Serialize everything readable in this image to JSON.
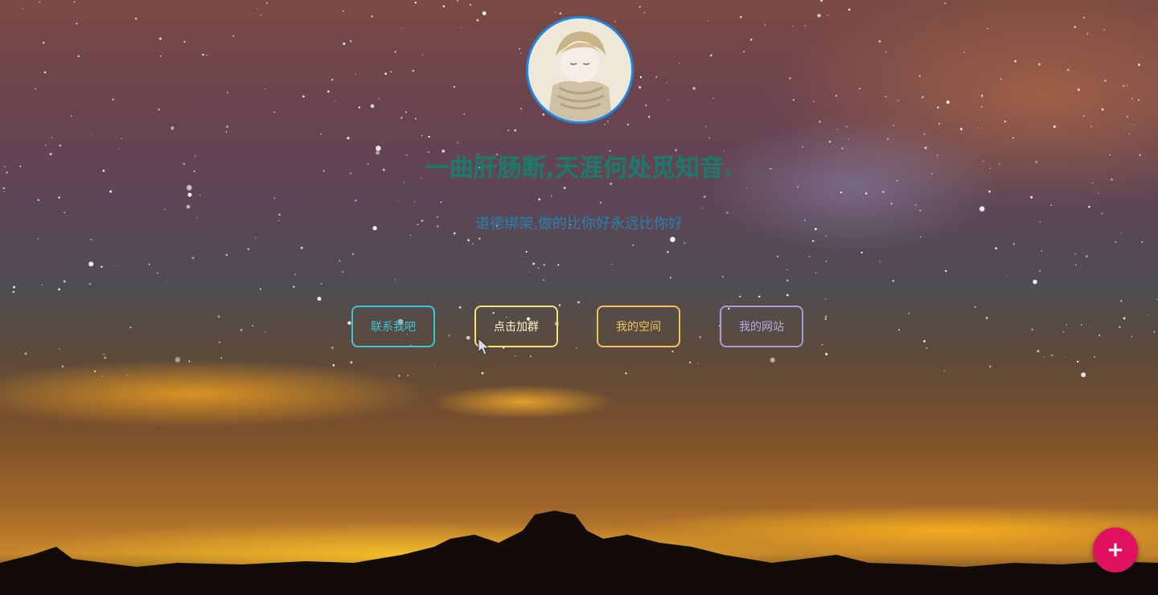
{
  "profile": {
    "title": "一曲肝肠断,天涯何处觅知音.",
    "subtitle": "道德绑架,做的比你好永远比你好"
  },
  "buttons": [
    {
      "label": "联系我吧",
      "color": "#3fc3d8"
    },
    {
      "label": "点击加群",
      "color": "#f3e27a"
    },
    {
      "label": "我的空间",
      "color": "#f3c35a"
    },
    {
      "label": "我的网站",
      "color": "#a59ed6"
    }
  ],
  "fab": {
    "label": "+",
    "color": "#e0115f"
  },
  "icons": {
    "avatar": "avatar-portrait",
    "cursor": "mouse-pointer-icon"
  }
}
